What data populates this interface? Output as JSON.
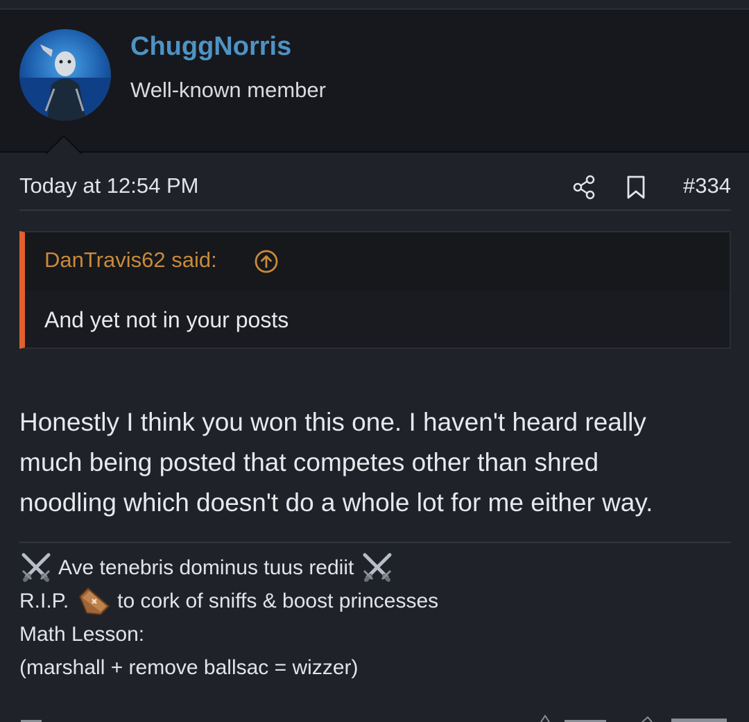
{
  "user": {
    "name": "ChuggNorris",
    "title": "Well-known member",
    "avatar_icon": "avatar-masked-figure"
  },
  "post": {
    "timestamp": "Today at 12:54 PM",
    "number": "#334",
    "share_icon": "share-icon",
    "bookmark_icon": "bookmark-icon",
    "quote": {
      "author": "DanTravis62 said:",
      "text": "And yet not in your posts",
      "jump_icon": "arrow-up-circle-icon"
    },
    "body_lines": [
      "Honestly I think you won this one. I haven't heard really",
      "much being posted that competes other than shred",
      "noodling which doesn't do a whole lot for me either way."
    ]
  },
  "signature": {
    "line1": "Ave tenebris dominus tuus rediit",
    "line2_pre": "R.I.P.",
    "line2_post": "to cork of sniffs & boost princesses",
    "line3": "Math Lesson:",
    "line4": "(marshall + remove ballsac = wizzer)",
    "icons": [
      "crossed-swords-icon",
      "coffin-icon"
    ]
  },
  "colors": {
    "username": "#4f93c4",
    "quote_accent": "#e2602d",
    "quote_author": "#c88a3a",
    "background": "#1f2229"
  }
}
